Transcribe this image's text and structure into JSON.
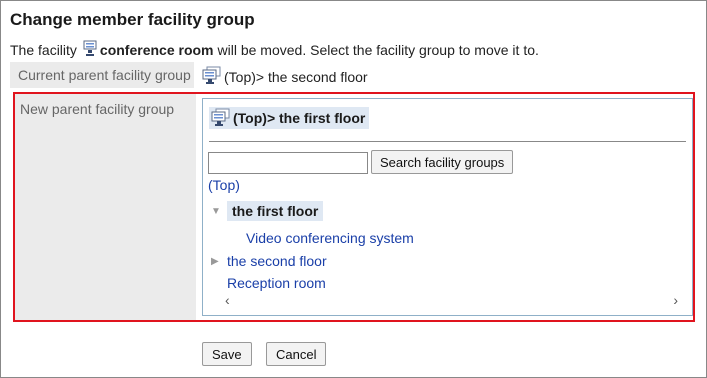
{
  "page_title": "Change member facility group",
  "intro": {
    "prefix": "The facility",
    "facility_name": "conference room",
    "suffix": "will be moved. Select the facility group to move it to."
  },
  "current_parent": {
    "label": "Current parent facility group",
    "value": "(Top)> the second floor"
  },
  "new_parent": {
    "label": "New parent facility group",
    "selected_path": "(Top)> the first floor",
    "search_input": {
      "value": "",
      "placeholder": ""
    },
    "search_button": "Search facility groups",
    "top_link": "(Top)",
    "tree": {
      "current_node": "the first floor",
      "child_item": "Video conferencing system",
      "sibling_node": "the second floor",
      "leaf_item": "Reception room"
    },
    "scroll_left": "‹",
    "scroll_right": "›"
  },
  "actions": {
    "save": "Save",
    "cancel": "Cancel"
  },
  "colors": {
    "link": "#1a3fa8",
    "highlight": "#dfe8f3",
    "error_border": "#e0141e",
    "label_bg": "#ebebeb"
  },
  "icons": {
    "facility": "facility-icon",
    "facility_group": "facility-group-icon",
    "expanded": "triangle-down-icon",
    "collapsed": "triangle-right-icon"
  }
}
